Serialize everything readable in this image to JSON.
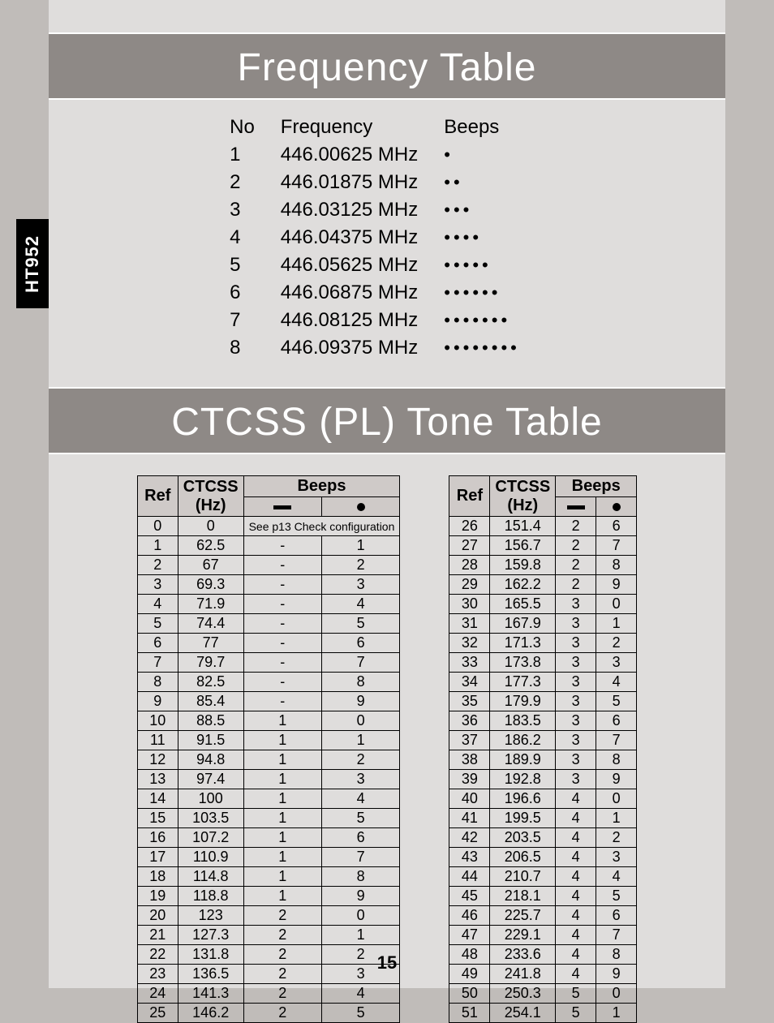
{
  "side_tab": "HT952",
  "page_number": "15",
  "freq_title": "Frequency Table",
  "freq_headers": {
    "no": "No",
    "freq": "Frequency",
    "beeps": "Beeps"
  },
  "freq_rows": [
    {
      "no": "1",
      "freq": "446.00625 MHz",
      "dots": 1
    },
    {
      "no": "2",
      "freq": "446.01875 MHz",
      "dots": 2
    },
    {
      "no": "3",
      "freq": "446.03125 MHz",
      "dots": 3
    },
    {
      "no": "4",
      "freq": "446.04375 MHz",
      "dots": 4
    },
    {
      "no": "5",
      "freq": "446.05625 MHz",
      "dots": 5
    },
    {
      "no": "6",
      "freq": "446.06875 MHz",
      "dots": 6
    },
    {
      "no": "7",
      "freq": "446.08125 MHz",
      "dots": 7
    },
    {
      "no": "8",
      "freq": "446.09375 MHz",
      "dots": 8
    }
  ],
  "ctcss_title": "CTCSS (PL) Tone Table",
  "ctcss_headers": {
    "ref": "Ref",
    "hz": "CTCSS (Hz)",
    "beeps": "Beeps"
  },
  "ctcss_note": "See p13 Check configuration",
  "ctcss_left": [
    {
      "ref": "0",
      "hz": "0",
      "long": "",
      "short": ""
    },
    {
      "ref": "1",
      "hz": "62.5",
      "long": "-",
      "short": "1"
    },
    {
      "ref": "2",
      "hz": "67",
      "long": "-",
      "short": "2"
    },
    {
      "ref": "3",
      "hz": "69.3",
      "long": "-",
      "short": "3"
    },
    {
      "ref": "4",
      "hz": "71.9",
      "long": "-",
      "short": "4"
    },
    {
      "ref": "5",
      "hz": "74.4",
      "long": "-",
      "short": "5"
    },
    {
      "ref": "6",
      "hz": "77",
      "long": "-",
      "short": "6"
    },
    {
      "ref": "7",
      "hz": "79.7",
      "long": "-",
      "short": "7"
    },
    {
      "ref": "8",
      "hz": "82.5",
      "long": "-",
      "short": "8"
    },
    {
      "ref": "9",
      "hz": "85.4",
      "long": "-",
      "short": "9"
    },
    {
      "ref": "10",
      "hz": "88.5",
      "long": "1",
      "short": "0"
    },
    {
      "ref": "11",
      "hz": "91.5",
      "long": "1",
      "short": "1"
    },
    {
      "ref": "12",
      "hz": "94.8",
      "long": "1",
      "short": "2"
    },
    {
      "ref": "13",
      "hz": "97.4",
      "long": "1",
      "short": "3"
    },
    {
      "ref": "14",
      "hz": "100",
      "long": "1",
      "short": "4"
    },
    {
      "ref": "15",
      "hz": "103.5",
      "long": "1",
      "short": "5"
    },
    {
      "ref": "16",
      "hz": "107.2",
      "long": "1",
      "short": "6"
    },
    {
      "ref": "17",
      "hz": "110.9",
      "long": "1",
      "short": "7"
    },
    {
      "ref": "18",
      "hz": "114.8",
      "long": "1",
      "short": "8"
    },
    {
      "ref": "19",
      "hz": "118.8",
      "long": "1",
      "short": "9"
    },
    {
      "ref": "20",
      "hz": "123",
      "long": "2",
      "short": "0"
    },
    {
      "ref": "21",
      "hz": "127.3",
      "long": "2",
      "short": "1"
    },
    {
      "ref": "22",
      "hz": "131.8",
      "long": "2",
      "short": "2"
    },
    {
      "ref": "23",
      "hz": "136.5",
      "long": "2",
      "short": "3"
    },
    {
      "ref": "24",
      "hz": "141.3",
      "long": "2",
      "short": "4"
    },
    {
      "ref": "25",
      "hz": "146.2",
      "long": "2",
      "short": "5"
    }
  ],
  "ctcss_right": [
    {
      "ref": "26",
      "hz": "151.4",
      "long": "2",
      "short": "6"
    },
    {
      "ref": "27",
      "hz": "156.7",
      "long": "2",
      "short": "7"
    },
    {
      "ref": "28",
      "hz": "159.8",
      "long": "2",
      "short": "8"
    },
    {
      "ref": "29",
      "hz": "162.2",
      "long": "2",
      "short": "9"
    },
    {
      "ref": "30",
      "hz": "165.5",
      "long": "3",
      "short": "0"
    },
    {
      "ref": "31",
      "hz": "167.9",
      "long": "3",
      "short": "1"
    },
    {
      "ref": "32",
      "hz": "171.3",
      "long": "3",
      "short": "2"
    },
    {
      "ref": "33",
      "hz": "173.8",
      "long": "3",
      "short": "3"
    },
    {
      "ref": "34",
      "hz": "177.3",
      "long": "3",
      "short": "4"
    },
    {
      "ref": "35",
      "hz": "179.9",
      "long": "3",
      "short": "5"
    },
    {
      "ref": "36",
      "hz": "183.5",
      "long": "3",
      "short": "6"
    },
    {
      "ref": "37",
      "hz": "186.2",
      "long": "3",
      "short": "7"
    },
    {
      "ref": "38",
      "hz": "189.9",
      "long": "3",
      "short": "8"
    },
    {
      "ref": "39",
      "hz": "192.8",
      "long": "3",
      "short": "9"
    },
    {
      "ref": "40",
      "hz": "196.6",
      "long": "4",
      "short": "0"
    },
    {
      "ref": "41",
      "hz": "199.5",
      "long": "4",
      "short": "1"
    },
    {
      "ref": "42",
      "hz": "203.5",
      "long": "4",
      "short": "2"
    },
    {
      "ref": "43",
      "hz": "206.5",
      "long": "4",
      "short": "3"
    },
    {
      "ref": "44",
      "hz": "210.7",
      "long": "4",
      "short": "4"
    },
    {
      "ref": "45",
      "hz": "218.1",
      "long": "4",
      "short": "5"
    },
    {
      "ref": "46",
      "hz": "225.7",
      "long": "4",
      "short": "6"
    },
    {
      "ref": "47",
      "hz": "229.1",
      "long": "4",
      "short": "7"
    },
    {
      "ref": "48",
      "hz": "233.6",
      "long": "4",
      "short": "8"
    },
    {
      "ref": "49",
      "hz": "241.8",
      "long": "4",
      "short": "9"
    },
    {
      "ref": "50",
      "hz": "250.3",
      "long": "5",
      "short": "0"
    },
    {
      "ref": "51",
      "hz": "254.1",
      "long": "5",
      "short": "1"
    }
  ]
}
